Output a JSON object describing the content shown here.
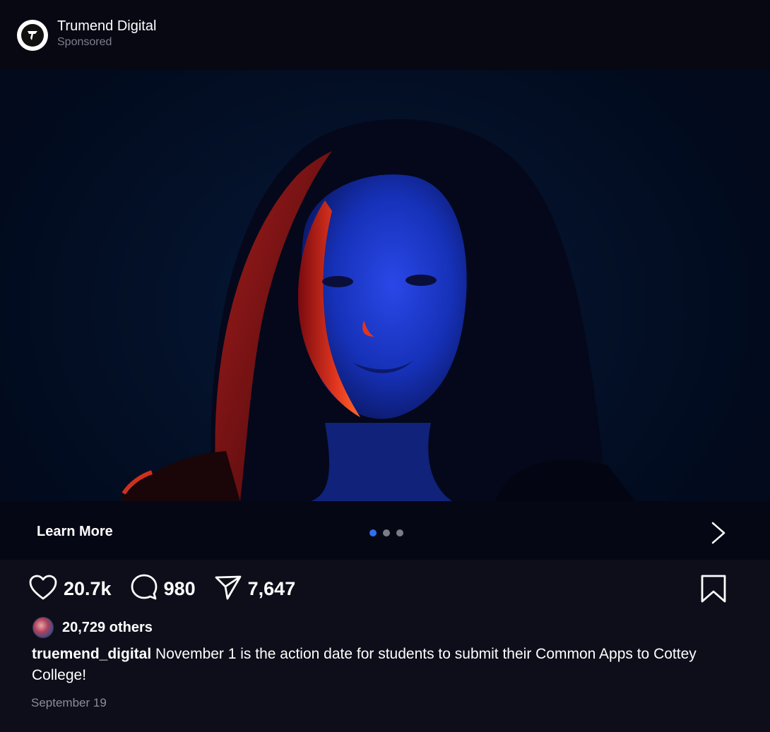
{
  "header": {
    "account_name": "Trumend Digital",
    "subtitle": "Sponsored",
    "avatar_icon": "trumend-logo-icon"
  },
  "media": {
    "description": "portrait-photo",
    "carousel": {
      "count": 3,
      "active_index": 0
    }
  },
  "cta": {
    "label": "Learn More",
    "arrow_icon": "chevron-right-icon"
  },
  "actions": {
    "like_count": "20.7k",
    "comment_count": "980",
    "share_count": "7,647",
    "icons": [
      "heart-icon",
      "comment-icon",
      "send-icon",
      "bookmark-icon"
    ]
  },
  "likes": {
    "text": "20,729 others"
  },
  "caption": {
    "username": "truemend_digital",
    "text": "November 1 is the action date for students to submit their Common Apps to Cottey College!"
  },
  "date": "September 19",
  "colors": {
    "background": "#0e0e1a",
    "header_bg": "#070812",
    "cta_bg": "#050714",
    "active_dot": "#2f6ff0",
    "muted_text": "#8a8d99"
  }
}
